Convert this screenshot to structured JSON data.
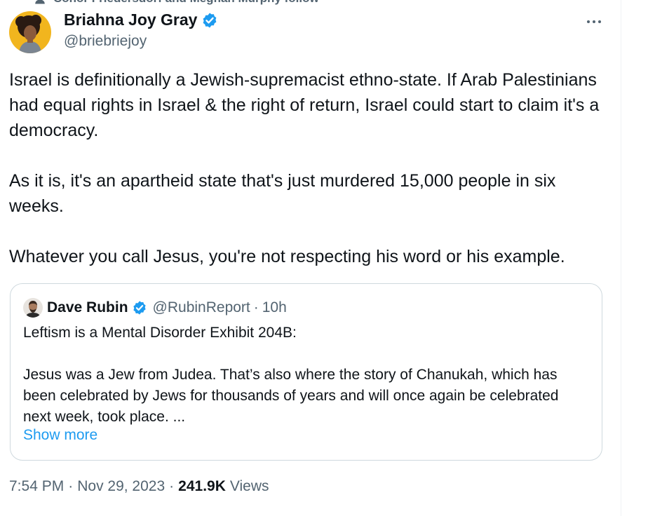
{
  "social_context": {
    "text": "Conor Friedersdorf and Meghan Murphy follow",
    "icon": "person-icon"
  },
  "author": {
    "name": "Briahna Joy Gray",
    "handle": "@briebriejoy",
    "verified": true,
    "avatar_icon": "avatar"
  },
  "more_icon": "more-dots-icon",
  "tweet": {
    "paragraphs": [
      "Israel is definitionally a Jewish-supremacist ethno-state. If Arab Palestinians had equal rights in Israel & the right of return, Israel could start to claim it's a democracy.",
      "As it is, it's an apartheid state that's just murdered 15,000 people in six weeks.",
      "Whatever you call Jesus, you're not respecting his word or his example."
    ]
  },
  "quote": {
    "name": "Dave Rubin",
    "handle": "@RubinReport",
    "separator": "·",
    "time": "10h",
    "verified": true,
    "paragraphs": [
      "Leftism is a Mental Disorder Exhibit 204B:",
      "Jesus was a Jew from Judea. That’s also where the story of Chanukah, which has been celebrated by Jews for thousands of years and will once again be celebrated next week, took place. ..."
    ],
    "show_more": "Show more"
  },
  "meta": {
    "time": "7:54 PM",
    "separator": "·",
    "date": "Nov 29, 2023",
    "views_count": "241.9K",
    "views_label": "Views"
  },
  "colors": {
    "verified_blue": "#1d9bf0",
    "secondary_text": "#536471",
    "border": "#cfd9de"
  }
}
